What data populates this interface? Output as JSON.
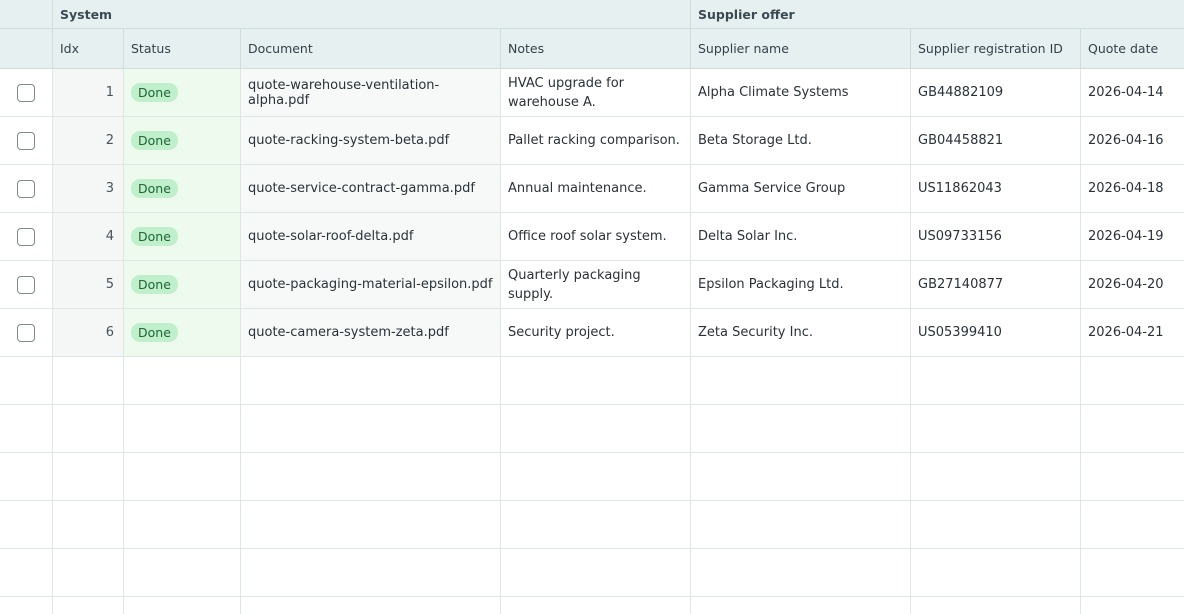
{
  "groups": {
    "system": "System",
    "supplier_offer": "Supplier offer"
  },
  "columns": {
    "idx": "Idx",
    "status": "Status",
    "document": "Document",
    "notes": "Notes",
    "supplier_name": "Supplier name",
    "supplier_registration_id": "Supplier registration ID",
    "quote_date": "Quote date"
  },
  "rows": [
    {
      "idx": "1",
      "status": "Done",
      "document": "quote-warehouse-ventilation-alpha.pdf",
      "notes": "HVAC upgrade for warehouse A.",
      "supplier_name": "Alpha Climate Systems",
      "supplier_registration_id": "GB44882109",
      "quote_date": "2026-04-14"
    },
    {
      "idx": "2",
      "status": "Done",
      "document": "quote-racking-system-beta.pdf",
      "notes": "Pallet racking comparison.",
      "supplier_name": "Beta Storage Ltd.",
      "supplier_registration_id": "GB04458821",
      "quote_date": "2026-04-16"
    },
    {
      "idx": "3",
      "status": "Done",
      "document": "quote-service-contract-gamma.pdf",
      "notes": "Annual maintenance.",
      "supplier_name": "Gamma Service Group",
      "supplier_registration_id": "US11862043",
      "quote_date": "2026-04-18"
    },
    {
      "idx": "4",
      "status": "Done",
      "document": "quote-solar-roof-delta.pdf",
      "notes": "Office roof solar system.",
      "supplier_name": "Delta Solar Inc.",
      "supplier_registration_id": "US09733156",
      "quote_date": "2026-04-19"
    },
    {
      "idx": "5",
      "status": "Done",
      "document": "quote-packaging-material-epsilon.pdf",
      "notes": "Quarterly packaging supply.",
      "supplier_name": "Epsilon Packaging Ltd.",
      "supplier_registration_id": "GB27140877",
      "quote_date": "2026-04-20"
    },
    {
      "idx": "6",
      "status": "Done",
      "document": "quote-camera-system-zeta.pdf",
      "notes": "Security project.",
      "supplier_name": "Zeta Security Inc.",
      "supplier_registration_id": "US05399410",
      "quote_date": "2026-04-21"
    }
  ],
  "colors": {
    "header_bg": "#e7f0f0",
    "status_badge_bg": "#bff0cb",
    "status_badge_text": "#216338",
    "status_column_bg": "#effaee"
  }
}
